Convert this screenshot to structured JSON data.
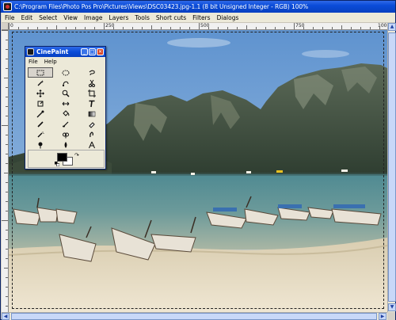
{
  "window": {
    "title": "C:\\Program Files\\Photo Pos Pro\\Pictures\\Views\\DSC03423.jpg-1.1 (8 bit Unsigned Integer - RGB) 100%"
  },
  "menu": [
    "File",
    "Edit",
    "Select",
    "View",
    "Image",
    "Layers",
    "Tools",
    "Short cuts",
    "Filters",
    "Dialogs"
  ],
  "ruler": {
    "labels": [
      "0",
      "250",
      "500",
      "750",
      "1000"
    ]
  },
  "toolbox": {
    "title": "CinePaint",
    "menu": [
      "File",
      "Help"
    ],
    "tools": [
      {
        "icon": "rect-select-icon",
        "active": true
      },
      {
        "icon": "ellipse-select-icon",
        "active": false
      },
      {
        "icon": "lasso-icon",
        "active": false
      },
      {
        "icon": "magic-wand-icon",
        "active": false
      },
      {
        "icon": "bezier-select-icon",
        "active": false
      },
      {
        "icon": "scissors-icon",
        "active": false
      },
      {
        "icon": "move-icon",
        "active": false
      },
      {
        "icon": "zoom-icon",
        "active": false
      },
      {
        "icon": "crop-icon",
        "active": false
      },
      {
        "icon": "transform-icon",
        "active": false
      },
      {
        "icon": "flip-icon",
        "active": false
      },
      {
        "icon": "text-icon",
        "active": false
      },
      {
        "icon": "color-picker-icon",
        "active": false
      },
      {
        "icon": "bucket-fill-icon",
        "active": false
      },
      {
        "icon": "gradient-icon",
        "active": false
      },
      {
        "icon": "pencil-icon",
        "active": false
      },
      {
        "icon": "paintbrush-icon",
        "active": false
      },
      {
        "icon": "eraser-icon",
        "active": false
      },
      {
        "icon": "airbrush-icon",
        "active": false
      },
      {
        "icon": "clone-icon",
        "active": false
      },
      {
        "icon": "smudge-icon",
        "active": false
      },
      {
        "icon": "dodge-burn-icon",
        "active": false
      },
      {
        "icon": "blur-icon",
        "active": false
      },
      {
        "icon": "measure-icon",
        "active": false
      }
    ],
    "fg_color": "#000000",
    "bg_color": "#ffffff"
  },
  "colors": {
    "title_bar": "#0a4cd8",
    "menu_bar": "#ece9d8",
    "sky": "#7aa6d6",
    "sea": "#5d8c96",
    "sand": "#e7dcc4"
  }
}
